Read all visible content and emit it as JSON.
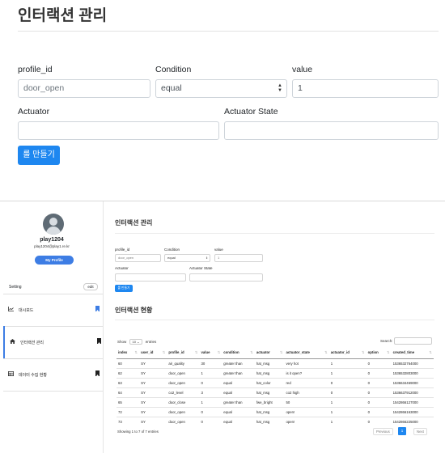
{
  "top": {
    "title": "인터랙션 관리",
    "fields": {
      "profile_id": {
        "label": "profile_id",
        "value": "door_open"
      },
      "condition": {
        "label": "Condition",
        "value": "equal"
      },
      "value": {
        "label": "value",
        "value": "1"
      },
      "actuator": {
        "label": "Actuator",
        "value": ""
      },
      "actuator_state": {
        "label": "Actuator State",
        "value": ""
      }
    },
    "create_button": "룰 만들기"
  },
  "sidebar": {
    "user_name": "play1204",
    "user_email": "play1204@play1.re.kr",
    "profile_button": "My Profile",
    "setting_label": "Setting",
    "edit_button": "edit",
    "nav": [
      {
        "label": "대시보드",
        "icon": "chart-line-icon",
        "bookmark_color": "#3d7de4"
      },
      {
        "label": "인터랙션 관리",
        "icon": "home-icon",
        "bookmark_color": "#222222"
      },
      {
        "label": "데이터 수집 현황",
        "icon": "table-icon",
        "bookmark_color": "#222222"
      }
    ]
  },
  "main": {
    "title": "인터랙션 관리",
    "fields": {
      "profile_id": {
        "label": "profile_id",
        "placeholder": "door_open"
      },
      "condition": {
        "label": "Condition",
        "value": "equal"
      },
      "value": {
        "label": "value",
        "value": "1"
      },
      "actuator": {
        "label": "Actuator",
        "value": ""
      },
      "actuator_state": {
        "label": "Actuator State",
        "value": ""
      }
    },
    "create_button": "룰 만들기",
    "status_title": "인터랙션 현황",
    "show_label": "Show",
    "entries_value": "10",
    "entries_label": "entries",
    "search_label": "Search:",
    "table": {
      "headers": [
        "index",
        "user_id",
        "profile_id",
        "value",
        "condition",
        "actuator",
        "actuator_state",
        "actuator_id",
        "option",
        "created_time"
      ],
      "rows": [
        [
          "60",
          "SY",
          "air_quality",
          "30",
          "greater than",
          "hat_msg",
          "very hot",
          "1",
          "0",
          "1536532764000"
        ],
        [
          "62",
          "SY",
          "door_open",
          "1",
          "greater than",
          "hat_msg",
          "is it open?",
          "1",
          "0",
          "1536532803000"
        ],
        [
          "63",
          "SY",
          "door_open",
          "0",
          "equal",
          "hat_color",
          "red",
          "0",
          "0",
          "1536634469000"
        ],
        [
          "64",
          "SY",
          "co2_level",
          "3",
          "equal",
          "hat_msg",
          "co2 high",
          "0",
          "0",
          "1536637912000"
        ],
        [
          "65",
          "SY",
          "door_close",
          "1",
          "greater than",
          "fwe_bright",
          "50",
          "1",
          "0",
          "1542866127000"
        ],
        [
          "72",
          "SY",
          "door_open",
          "0",
          "equal",
          "hat_msg",
          "open!",
          "1",
          "0",
          "1542866163000"
        ],
        [
          "73",
          "SY",
          "door_open",
          "0",
          "equal",
          "hat_msg",
          "open!",
          "1",
          "0",
          "1542866225000"
        ]
      ]
    },
    "showing_text": "Showing 1 to 7 of 7 entries",
    "prev_label": "Previous",
    "page_label": "1",
    "next_label": "Next"
  },
  "colors": {
    "accent": "#1e87f0",
    "profile_button": "#3d7de4"
  }
}
